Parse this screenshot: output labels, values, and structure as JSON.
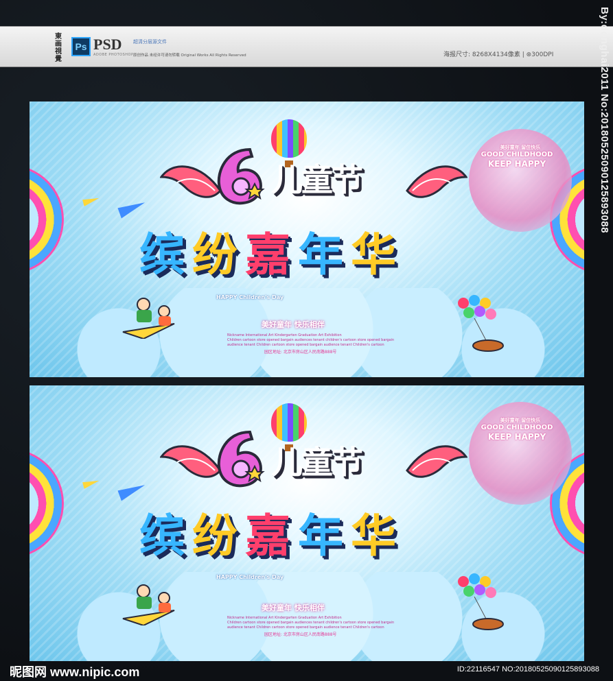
{
  "header": {
    "brand_logo": "東\n画\n視\n覺",
    "ps_icon_text": "Ps",
    "psd_label": "PSD",
    "psd_sub": "ADOBE PHOTOSHOP",
    "psd_desc": "超清分层源文件",
    "psd_desc2": "原创作品  未经许可请勿转载  Original Works  All Rights Reserved",
    "spec": "海报尺寸: 8268X4134像素 | ⊛300DPI"
  },
  "poster": {
    "festival_title": "儿童节",
    "main_title": [
      "缤",
      "纷",
      "嘉",
      "年",
      "华"
    ],
    "six": "6",
    "english_title": "HAPPY Children's Day",
    "slogan": "美好童年  快乐相伴",
    "sub_line_1": "Nickname International Art Kindergarten Graduation Art Exhibition",
    "sub_line_2": "Children cartoon store opened bargain audiences tenant children's cartoon store opened bargain",
    "sub_line_3": "audience tenant Children cartoon store opened bargain audience tenant Children's cartoon",
    "address": "园区地址: 北京市房山区人民南路888号",
    "badge_line_1": "美好童年  留住快乐",
    "badge_line_2": "GOOD CHILDHOOD",
    "badge_line_3": "KEEP HAPPY"
  },
  "watermark_side": "By:donghai2011 No:20180525090125893088",
  "footer": {
    "logo": "昵图网 www.nipic.com",
    "id": "ID:22116547 NO:20180525090125893088"
  },
  "colors": {
    "accent_blue": "#37b6ff",
    "accent_yellow": "#ffcb26",
    "accent_pink": "#ff3f6c",
    "background": "#111418"
  }
}
